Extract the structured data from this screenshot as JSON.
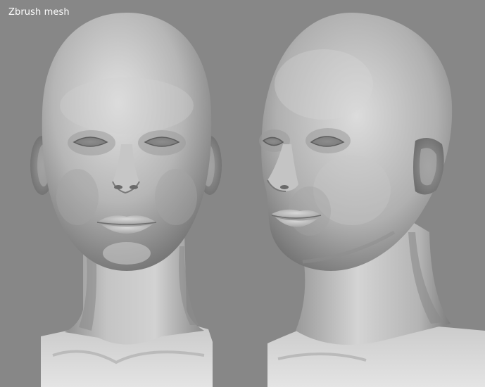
{
  "caption": "Zbrush mesh",
  "background_color": "#878787",
  "mesh_color": "#bdbdbd",
  "views": [
    {
      "label": "",
      "subject": "front-view-head-mesh"
    },
    {
      "label": "",
      "subject": "three-quarter-view-head-mesh"
    }
  ]
}
